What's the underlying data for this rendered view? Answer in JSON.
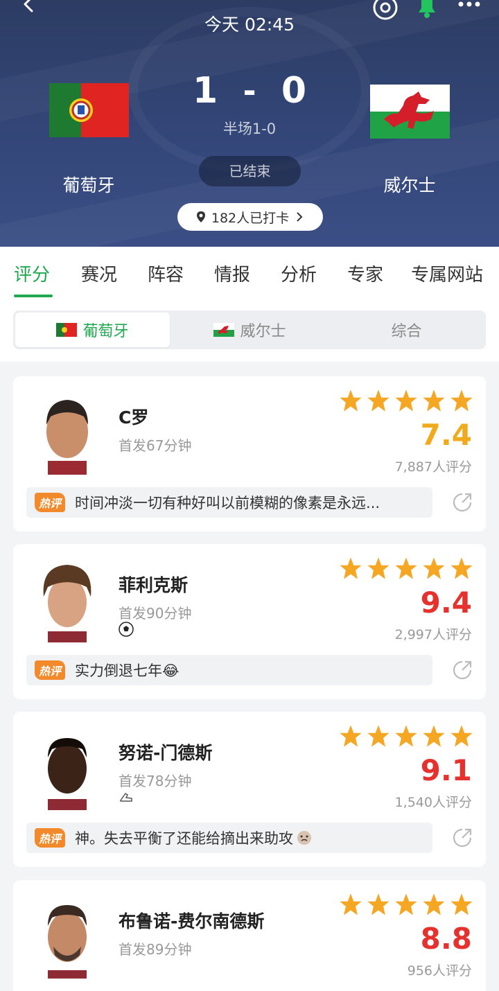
{
  "header": {
    "time": "今天 02:45",
    "score_home": "1",
    "score_sep": "-",
    "score_away": "0",
    "halftime": "半场1-0",
    "status": "已结束",
    "checkin": "182人已打卡",
    "home_team": "葡萄牙",
    "away_team": "威尔士"
  },
  "tabs": [
    "评分",
    "赛况",
    "阵容",
    "情报",
    "分析",
    "专家",
    "专属网站"
  ],
  "subtabs": [
    "葡萄牙",
    "威尔士",
    "综合"
  ],
  "hot_label": "热评",
  "players": [
    {
      "name": "C罗",
      "sub": "首发67分钟",
      "rating": "7.4",
      "votes": "7,887人评分",
      "comment": "时间冲淡一切有种好叫以前模糊的像素是永远...",
      "event": ""
    },
    {
      "name": "菲利克斯",
      "sub": "首发90分钟",
      "rating": "9.4",
      "votes": "2,997人评分",
      "comment": "实力倒退七年😂",
      "event": "goal"
    },
    {
      "name": "努诺-门德斯",
      "sub": "首发78分钟",
      "rating": "9.1",
      "votes": "1,540人评分",
      "comment": "神。失去平衡了还能给摘出来助攻",
      "event": "assist"
    },
    {
      "name": "布鲁诺-费尔南德斯",
      "sub": "首发89分钟",
      "rating": "8.8",
      "votes": "956人评分",
      "comment": "",
      "event": ""
    }
  ],
  "colors": {
    "accent": "#1fa84f",
    "rating_gold": "#f0ab1d",
    "rating_red": "#e5322e",
    "star": "#f5a623"
  }
}
